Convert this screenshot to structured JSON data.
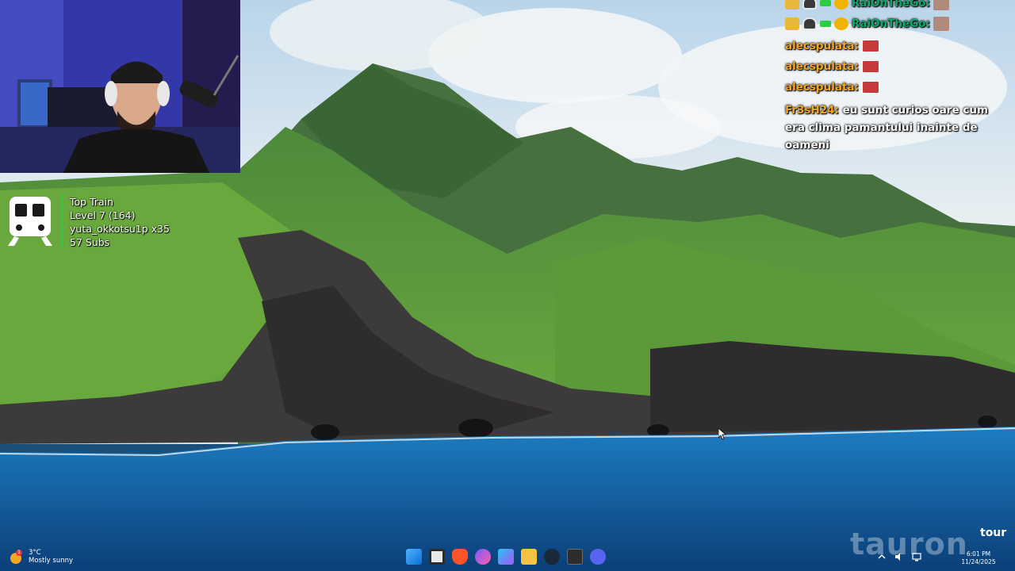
{
  "stream": {
    "train": {
      "icon": "train-icon",
      "title": "Top Train",
      "level": "Level 7  (164)",
      "top_user": "yuta_okkotsu1p x35",
      "subs": "57 Subs",
      "accent_color": "#35c44a"
    },
    "chat": {
      "messages": [
        {
          "username": "RaiOnTheGo:",
          "badges": [
            "crown-badge",
            "mask-badge",
            "green-badge",
            "coin-badge"
          ],
          "trailing": "avatar-emote"
        },
        {
          "username": "RaiOnTheGo:",
          "badges": [
            "crown-badge",
            "mask-badge",
            "green-badge",
            "coin-badge"
          ],
          "trailing": "avatar-emote"
        },
        {
          "username": "alecspulata:",
          "badges": [],
          "trailing": "asap-emote"
        },
        {
          "username": "alecspulata:",
          "badges": [],
          "trailing": "asap-emote"
        },
        {
          "username": "alecspulata:",
          "badges": [],
          "trailing": "asap-emote"
        },
        {
          "username": "Fr3sH24:",
          "text": "eu sunt curios oare cum era clima pamantului inainte de oameni"
        }
      ]
    }
  },
  "taskbar": {
    "weather": {
      "temp": "3°C",
      "condition": "Mostly sunny",
      "badge": "1"
    },
    "apps": [
      "windows-start-icon",
      "task-view-icon",
      "brave-icon",
      "app-icon",
      "app-icon",
      "file-explorer-icon",
      "steam-icon",
      "terminal-icon",
      "discord-icon"
    ],
    "clock": {
      "time": "6:01 PM",
      "date": "11/24/2025"
    }
  },
  "watermark": {
    "text": "tauron",
    "small": "tour"
  },
  "colors": {
    "sea": "#1769a8",
    "sky": "#dfe8ec",
    "mountain": "#3f7a3a",
    "cliff": "#3d3a3c"
  }
}
